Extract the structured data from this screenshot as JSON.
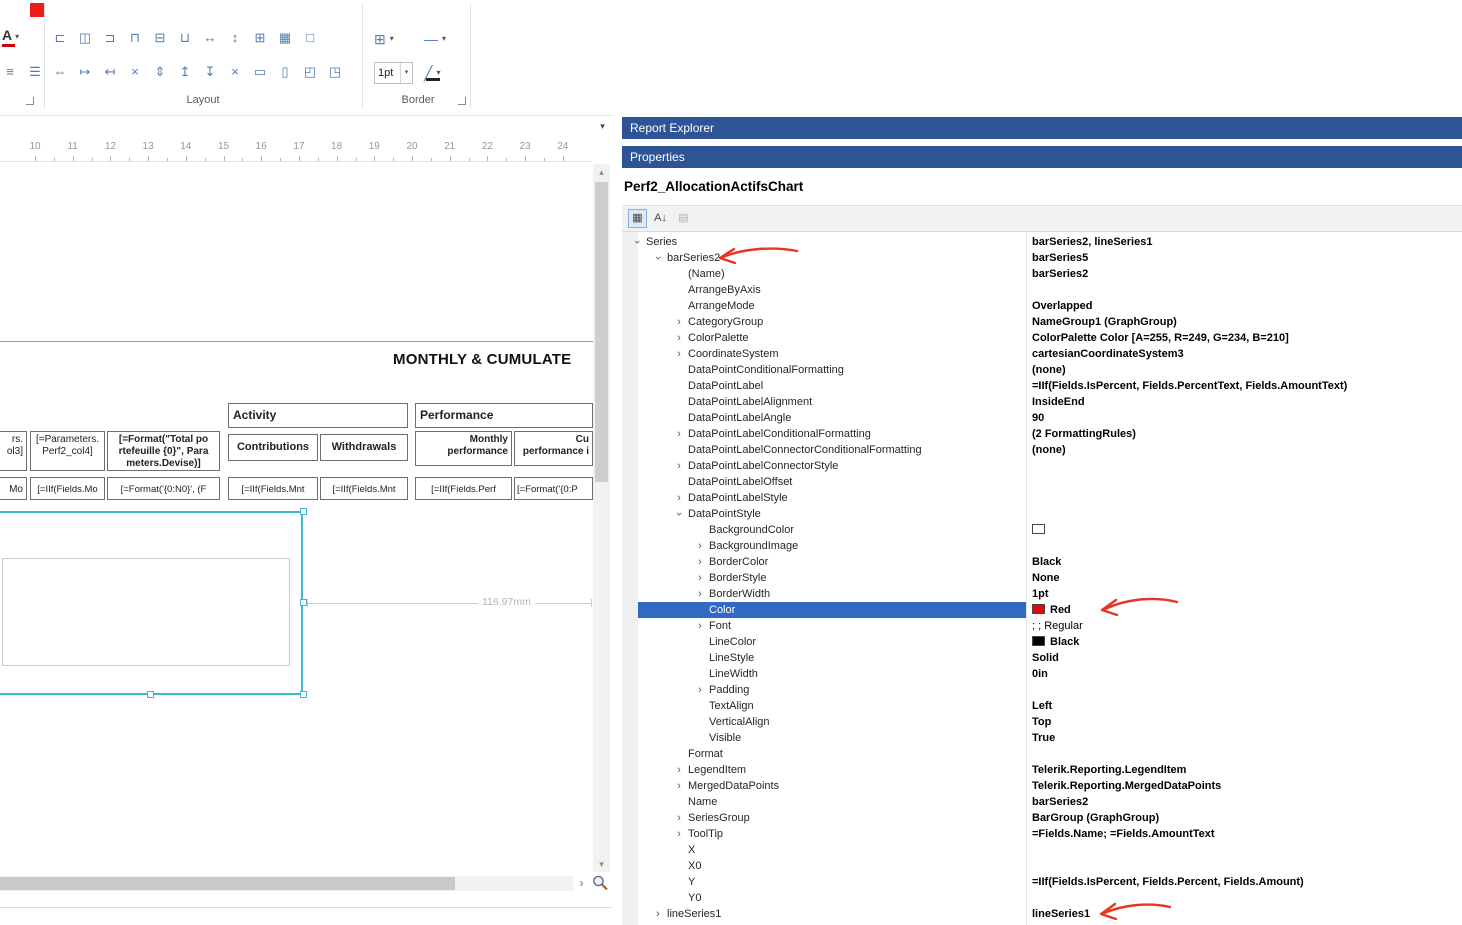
{
  "colors": {
    "panel_header": "#2d5596",
    "row_selection": "#316AC5",
    "chart_selection": "#3cb8cf",
    "annotation": "#ea3323",
    "red_value_swatch": "#e00a0a",
    "ribbon_red_swatch": "#ed1c1c"
  },
  "ribbon": {
    "font_color_label": "A",
    "left_icons": [
      {
        "name": "align-left-text-icon",
        "glyph": "≡"
      },
      {
        "name": "justify-text-icon",
        "glyph": "☰"
      }
    ],
    "layout_group": {
      "label": "Layout",
      "row1": [
        {
          "name": "align-lefts-icon",
          "glyph": "⊏"
        },
        {
          "name": "align-centers-icon",
          "glyph": "◫"
        },
        {
          "name": "align-rights-icon",
          "glyph": "⊐"
        },
        {
          "name": "align-tops-icon",
          "glyph": "⊓"
        },
        {
          "name": "align-middles-icon",
          "glyph": "⊟"
        },
        {
          "name": "align-bottoms-icon",
          "glyph": "⊔"
        },
        {
          "name": "make-same-width-icon",
          "glyph": "↔"
        },
        {
          "name": "make-same-height-icon",
          "glyph": "↕"
        },
        {
          "name": "make-same-size-icon",
          "glyph": "⊞"
        },
        {
          "name": "size-to-grid-icon",
          "glyph": "▦"
        },
        {
          "name": "snap-to-grid-icon",
          "glyph": "□"
        }
      ],
      "row2": [
        {
          "name": "make-horizontal-spacing-equal-icon",
          "glyph": "⇔"
        },
        {
          "name": "increase-horizontal-spacing-icon",
          "glyph": "↦"
        },
        {
          "name": "decrease-horizontal-spacing-icon",
          "glyph": "↤"
        },
        {
          "name": "remove-horizontal-spacing-icon",
          "glyph": "×"
        },
        {
          "name": "make-vertical-spacing-equal-icon",
          "glyph": "⇕"
        },
        {
          "name": "increase-vertical-spacing-icon",
          "glyph": "↥"
        },
        {
          "name": "decrease-vertical-spacing-icon",
          "glyph": "↧"
        },
        {
          "name": "remove-vertical-spacing-icon",
          "glyph": "×"
        },
        {
          "name": "center-horizontally-icon",
          "glyph": "▭"
        },
        {
          "name": "center-vertically-icon",
          "glyph": "▯"
        },
        {
          "name": "bring-to-front-icon",
          "glyph": "◰"
        },
        {
          "name": "send-to-back-icon",
          "glyph": "◳"
        }
      ]
    },
    "border_group": {
      "label": "Border",
      "borders_glyph": "⊞",
      "line_style_glyph": "—",
      "width_value": "1pt",
      "line_color_glyph": "╱"
    },
    "chevron_glyph": "▾"
  },
  "ruler": {
    "numbers": [
      "10",
      "11",
      "12",
      "13",
      "14",
      "15",
      "16",
      "17",
      "18",
      "19",
      "20",
      "21",
      "22",
      "23",
      "24"
    ],
    "dropdown_glyph": "▾"
  },
  "design": {
    "section_title": "MONTHLY & CUMULATE",
    "dimension_label": "116.97mm",
    "table": {
      "header_activity": "Activity",
      "header_performance": "Performance",
      "row1": [
        "rs.\nol3]",
        "[=Parameters.\nPerf2_col4]",
        "[=Format(\"Total po\nrtefeuille {0}\", Para\nmeters.Devise)]",
        "Contributions",
        "Withdrawals",
        "Monthly\nperformance",
        "Cu\nperformance i"
      ],
      "row2": [
        "Mo",
        "[=IIf(Fields.Mo",
        "[=Format('{0:N0}', (F",
        "[=IIf(Fields.Mnt",
        "[=IIf(Fields.Mnt",
        "[=IIf(Fields.Perf",
        "[=Format('{0:P"
      ]
    },
    "scrollbar": {
      "up_glyph": "▴",
      "down_glyph": "▾",
      "right_glyph": "›"
    }
  },
  "panel": {
    "report_explorer_title": "Report Explorer",
    "properties_title": "Properties",
    "object_name": "Perf2_AllocationActifsChart",
    "toolbar_icons": [
      {
        "name": "categorized-icon",
        "glyph": "▦",
        "pressed": true
      },
      {
        "name": "alphabetical-sort-icon",
        "glyph": "A↓"
      },
      {
        "name": "property-pages-icon",
        "glyph": "▤",
        "disabled": true
      }
    ]
  },
  "property_grid": {
    "expander_glyph": "›",
    "rows": [
      {
        "name": "Series",
        "value": "barSeries2, lineSeries1",
        "indent": 0,
        "exp": "v",
        "vb": true
      },
      {
        "name": "barSeries2",
        "value": "barSeries5",
        "indent": 1,
        "exp": "v",
        "vb": true
      },
      {
        "name": "(Name)",
        "value": "barSeries2",
        "indent": 2,
        "exp": "",
        "vb": true
      },
      {
        "name": "ArrangeByAxis",
        "value": "",
        "indent": 2,
        "exp": ""
      },
      {
        "name": "ArrangeMode",
        "value": "Overlapped",
        "indent": 2,
        "exp": "",
        "vb": true
      },
      {
        "name": "CategoryGroup",
        "value": "NameGroup1 (GraphGroup)",
        "indent": 2,
        "exp": ">",
        "vb": true
      },
      {
        "name": "ColorPalette",
        "value": "ColorPalette Color [A=255, R=249, G=234, B=210]",
        "indent": 2,
        "exp": ">",
        "vb": true
      },
      {
        "name": "CoordinateSystem",
        "value": "cartesianCoordinateSystem3",
        "indent": 2,
        "exp": ">",
        "vb": true
      },
      {
        "name": "DataPointConditionalFormatting",
        "value": "(none)",
        "indent": 2,
        "exp": "",
        "vb": true
      },
      {
        "name": "DataPointLabel",
        "value": "=IIf(Fields.IsPercent, Fields.PercentText, Fields.AmountText)",
        "indent": 2,
        "exp": "",
        "vb": true
      },
      {
        "name": "DataPointLabelAlignment",
        "value": "InsideEnd",
        "indent": 2,
        "exp": "",
        "vb": true
      },
      {
        "name": "DataPointLabelAngle",
        "value": "90",
        "indent": 2,
        "exp": "",
        "vb": true
      },
      {
        "name": "DataPointLabelConditionalFormatting",
        "value": "(2 FormattingRules)",
        "indent": 2,
        "exp": ">",
        "vb": true
      },
      {
        "name": "DataPointLabelConnectorConditionalFormatting",
        "value": "(none)",
        "indent": 2,
        "exp": "",
        "vb": true
      },
      {
        "name": "DataPointLabelConnectorStyle",
        "value": "",
        "indent": 2,
        "exp": ">"
      },
      {
        "name": "DataPointLabelOffset",
        "value": "",
        "indent": 2,
        "exp": ""
      },
      {
        "name": "DataPointLabelStyle",
        "value": "",
        "indent": 2,
        "exp": ">"
      },
      {
        "name": "DataPointStyle",
        "value": "",
        "indent": 2,
        "exp": "v"
      },
      {
        "name": "BackgroundColor",
        "value": "",
        "indent": 3,
        "exp": "",
        "swatch": "#ffffff"
      },
      {
        "name": "BackgroundImage",
        "value": "",
        "indent": 3,
        "exp": ">"
      },
      {
        "name": "BorderColor",
        "value": "Black",
        "indent": 3,
        "exp": ">",
        "vb": true
      },
      {
        "name": "BorderStyle",
        "value": "None",
        "indent": 3,
        "exp": ">",
        "vb": true
      },
      {
        "name": "BorderWidth",
        "value": "1pt",
        "indent": 3,
        "exp": ">",
        "vb": true
      },
      {
        "name": "Color",
        "value": "Red",
        "indent": 3,
        "exp": "",
        "vb": true,
        "swatch": "#e00a0a",
        "sel": true
      },
      {
        "name": "Font",
        "value": "; ; Regular",
        "indent": 3,
        "exp": ">"
      },
      {
        "name": "LineColor",
        "value": "Black",
        "indent": 3,
        "exp": "",
        "vb": true,
        "swatch": "#000000"
      },
      {
        "name": "LineStyle",
        "value": "Solid",
        "indent": 3,
        "exp": "",
        "vb": true
      },
      {
        "name": "LineWidth",
        "value": "0in",
        "indent": 3,
        "exp": "",
        "vb": true
      },
      {
        "name": "Padding",
        "value": "",
        "indent": 3,
        "exp": ">"
      },
      {
        "name": "TextAlign",
        "value": "Left",
        "indent": 3,
        "exp": "",
        "vb": true
      },
      {
        "name": "VerticalAlign",
        "value": "Top",
        "indent": 3,
        "exp": "",
        "vb": true
      },
      {
        "name": "Visible",
        "value": "True",
        "indent": 3,
        "exp": "",
        "vb": true
      },
      {
        "name": "Format",
        "value": "",
        "indent": 2,
        "exp": ""
      },
      {
        "name": "LegendItem",
        "value": "Telerik.Reporting.LegendItem",
        "indent": 2,
        "exp": ">",
        "vb": true
      },
      {
        "name": "MergedDataPoints",
        "value": "Telerik.Reporting.MergedDataPoints",
        "indent": 2,
        "exp": ">",
        "vb": true
      },
      {
        "name": "Name",
        "value": "barSeries2",
        "indent": 2,
        "exp": "",
        "vb": true
      },
      {
        "name": "SeriesGroup",
        "value": "BarGroup (GraphGroup)",
        "indent": 2,
        "exp": ">",
        "vb": true
      },
      {
        "name": "ToolTip",
        "value": "=Fields.Name; =Fields.AmountText",
        "indent": 2,
        "exp": ">",
        "vb": true
      },
      {
        "name": "X",
        "value": "",
        "indent": 2,
        "exp": ""
      },
      {
        "name": "X0",
        "value": "",
        "indent": 2,
        "exp": ""
      },
      {
        "name": "Y",
        "value": "=IIf(Fields.IsPercent, Fields.Percent, Fields.Amount)",
        "indent": 2,
        "exp": "",
        "vb": true
      },
      {
        "name": "Y0",
        "value": "",
        "indent": 2,
        "exp": ""
      },
      {
        "name": "lineSeries1",
        "value": "lineSeries1",
        "indent": 1,
        "exp": ">",
        "vb": true
      }
    ]
  }
}
